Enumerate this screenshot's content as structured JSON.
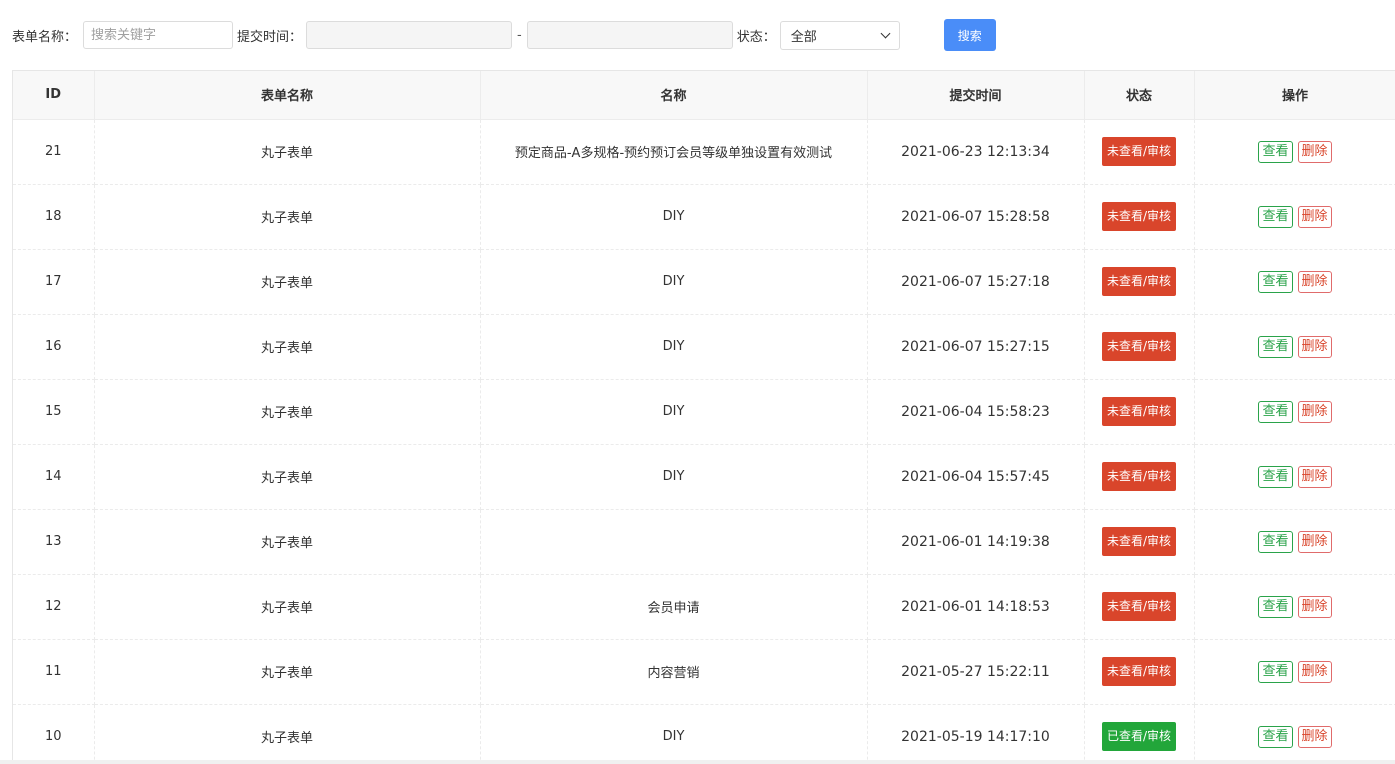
{
  "filters": {
    "form_name_label": "表单名称：",
    "search_placeholder": "搜索关键字",
    "search_value": "",
    "submit_time_label": "提交时间：",
    "date_start_value": "",
    "date_end_value": "",
    "date_separator": "-",
    "status_label": "状态：",
    "status_selected": "全部",
    "search_button": "搜索"
  },
  "table": {
    "headers": {
      "id": "ID",
      "form_name": "表单名称",
      "name": "名称",
      "submit_time": "提交时间",
      "status": "状态",
      "actions": "操作"
    },
    "view_label": "查看",
    "delete_label": "删除",
    "rows": [
      {
        "id": "21",
        "form_name": "丸子表单",
        "name": "预定商品-A多规格-预约预订会员等级单独设置有效测试",
        "time": "2021-06-23 12:13:34",
        "status": "未查看/审核",
        "status_color": "#d9452b"
      },
      {
        "id": "18",
        "form_name": "丸子表单",
        "name": "DIY",
        "time": "2021-06-07 15:28:58",
        "status": "未查看/审核",
        "status_color": "#d9452b"
      },
      {
        "id": "17",
        "form_name": "丸子表单",
        "name": "DIY",
        "time": "2021-06-07 15:27:18",
        "status": "未查看/审核",
        "status_color": "#d9452b"
      },
      {
        "id": "16",
        "form_name": "丸子表单",
        "name": "DIY",
        "time": "2021-06-07 15:27:15",
        "status": "未查看/审核",
        "status_color": "#d9452b"
      },
      {
        "id": "15",
        "form_name": "丸子表单",
        "name": "DIY",
        "time": "2021-06-04 15:58:23",
        "status": "未查看/审核",
        "status_color": "#d9452b"
      },
      {
        "id": "14",
        "form_name": "丸子表单",
        "name": "DIY",
        "time": "2021-06-04 15:57:45",
        "status": "未查看/审核",
        "status_color": "#d9452b"
      },
      {
        "id": "13",
        "form_name": "丸子表单",
        "name": "",
        "time": "2021-06-01 14:19:38",
        "status": "未查看/审核",
        "status_color": "#d9452b"
      },
      {
        "id": "12",
        "form_name": "丸子表单",
        "name": "会员申请",
        "time": "2021-06-01 14:18:53",
        "status": "未查看/审核",
        "status_color": "#d9452b"
      },
      {
        "id": "11",
        "form_name": "丸子表单",
        "name": "内容营销",
        "time": "2021-05-27 15:22:11",
        "status": "未查看/审核",
        "status_color": "#d9452b"
      },
      {
        "id": "10",
        "form_name": "丸子表单",
        "name": "DIY",
        "time": "2021-05-19 14:17:10",
        "status": "已查看/审核",
        "status_color": "#22a63a"
      }
    ]
  }
}
